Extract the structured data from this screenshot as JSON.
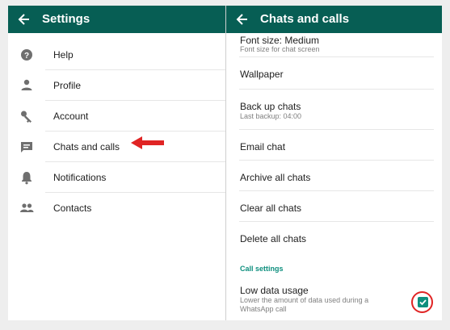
{
  "left_pane": {
    "title": "Settings",
    "items": [
      {
        "label": "Help",
        "icon": "help-icon"
      },
      {
        "label": "Profile",
        "icon": "person-icon"
      },
      {
        "label": "Account",
        "icon": "key-icon"
      },
      {
        "label": "Chats and calls",
        "icon": "chat-icon"
      },
      {
        "label": "Notifications",
        "icon": "bell-icon"
      },
      {
        "label": "Contacts",
        "icon": "contacts-icon"
      }
    ]
  },
  "right_pane": {
    "title": "Chats and calls",
    "font_size_title": "Font size: Medium",
    "font_size_sub": "Font size for chat screen",
    "wallpaper": "Wallpaper",
    "backup_title": "Back up chats",
    "backup_sub": "Last backup: 04:00",
    "email_chat": "Email chat",
    "archive_all": "Archive all chats",
    "clear_all": "Clear all chats",
    "delete_all": "Delete all chats",
    "call_settings_header": "Call settings",
    "low_data_title": "Low data usage",
    "low_data_sub": "Lower the amount of data used during a WhatsApp call",
    "low_data_checked": true
  },
  "colors": {
    "appbar": "#075e54",
    "accent": "#0e8f7e",
    "annotation": "#e02424"
  }
}
